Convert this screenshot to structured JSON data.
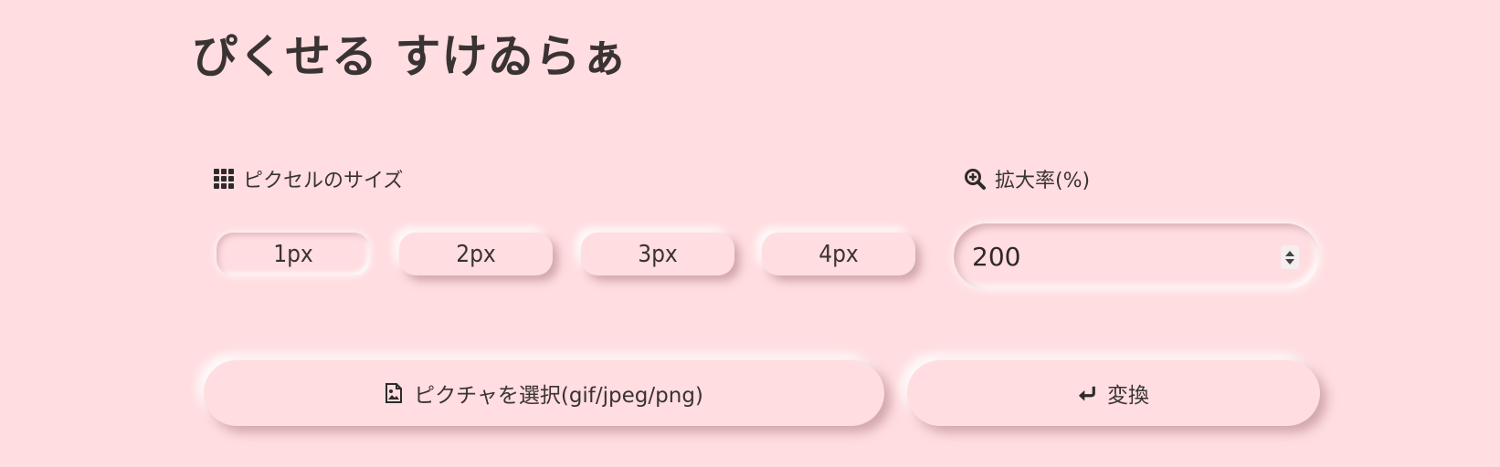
{
  "title": "ぴくせる すけゐらぁ",
  "pixel_size": {
    "label": "ピクセルのサイズ",
    "icon": "grid-icon",
    "options": [
      "1px",
      "2px",
      "3px",
      "4px"
    ],
    "selected": "1px"
  },
  "zoom": {
    "label": "拡大率(%)",
    "icon": "zoom-in-icon",
    "value": "200"
  },
  "actions": {
    "select_label": "ピクチャを選択(gif/jpeg/png)",
    "select_icon": "image-file-icon",
    "convert_label": "変換",
    "convert_icon": "enter-arrow-icon"
  },
  "colors": {
    "background": "#ffdde0",
    "text": "#3a3333"
  }
}
